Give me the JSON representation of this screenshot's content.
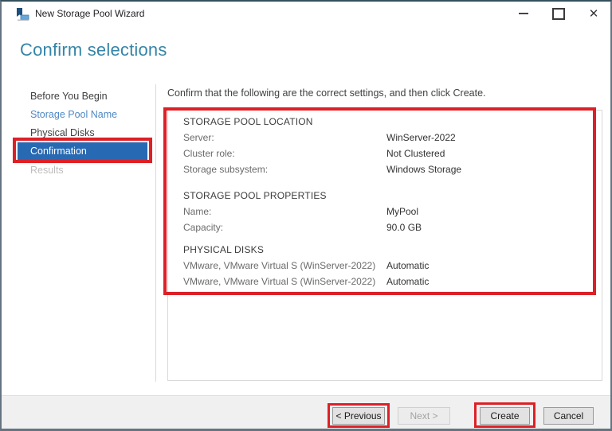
{
  "window": {
    "title": "New Storage Pool Wizard"
  },
  "titlebar": {
    "close_glyph": "✕"
  },
  "heading": "Confirm selections",
  "sidebar": {
    "items": [
      {
        "label": "Before You Begin",
        "state": "enabled"
      },
      {
        "label": "Storage Pool Name",
        "state": "enabled"
      },
      {
        "label": "Physical Disks",
        "state": "enabled"
      },
      {
        "label": "Confirmation",
        "state": "selected"
      },
      {
        "label": "Results",
        "state": "disabled"
      }
    ]
  },
  "main": {
    "instruction": "Confirm that the following are the correct settings, and then click Create.",
    "sections": [
      {
        "title": "STORAGE POOL LOCATION",
        "rows": [
          {
            "label": "Server:",
            "value": "WinServer-2022"
          },
          {
            "label": "Cluster role:",
            "value": "Not Clustered"
          },
          {
            "label": "Storage subsystem:",
            "value": "Windows Storage"
          }
        ]
      },
      {
        "title": "STORAGE POOL PROPERTIES",
        "rows": [
          {
            "label": "Name:",
            "value": "MyPool"
          },
          {
            "label": "Capacity:",
            "value": "90.0 GB"
          }
        ]
      },
      {
        "title": "PHYSICAL DISKS",
        "rows": [
          {
            "label": "VMware, VMware Virtual S (WinServer-2022)",
            "value": "Automatic"
          },
          {
            "label": "VMware, VMware Virtual S (WinServer-2022)",
            "value": "Automatic"
          }
        ]
      }
    ]
  },
  "footer": {
    "previous_label": "< Previous",
    "next_label": "Next >",
    "create_label": "Create",
    "cancel_label": "Cancel"
  },
  "colors": {
    "annotation": "#dd2026",
    "selected_nav_bg": "#2769b2",
    "heading": "#3585a8"
  }
}
